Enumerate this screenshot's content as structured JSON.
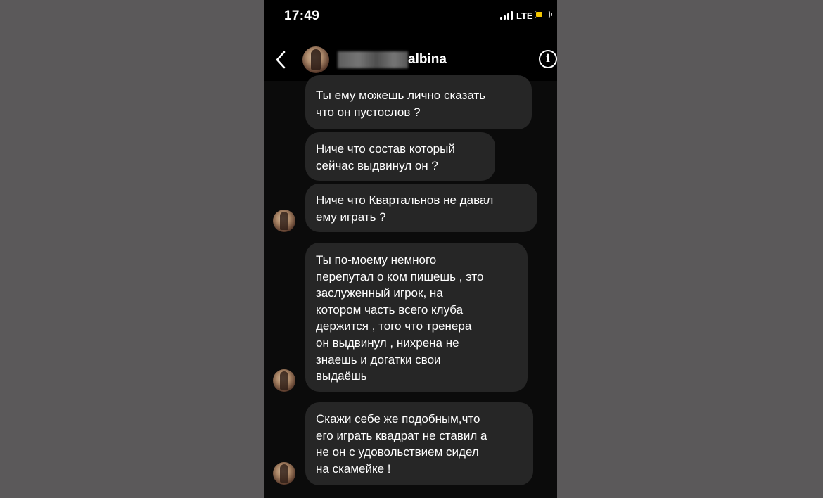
{
  "status_bar": {
    "time": "17:49",
    "network": "LTE",
    "battery_level": 0.55,
    "battery_color": "#f2c500"
  },
  "header": {
    "username": "albina",
    "back_icon": "chevron-left-icon",
    "info_icon": "info-icon",
    "info_glyph": "i"
  },
  "messages": [
    {
      "text": "Ты ему можешь лично сказать\nчто он пустослов ?"
    },
    {
      "text": "Ниче что состав который\nсейчас выдвинул он ?"
    },
    {
      "text": "Ниче что Квартальнов не давал\nему играть ?"
    },
    {
      "text": "Ты по-моему немного\nперепутал о ком пишешь , это\nзаслуженный игрок, на\nкотором часть всего клуба\nдержится  , того что тренера\nон выдвинул , нихрена не\nзнаешь и догатки свои\nвыдаёшь"
    },
    {
      "text": "Скажи себе же подобным,что\nего играть квадрат не ставил а\nне он с удовольствием сидел\nна скамейке !"
    }
  ],
  "colors": {
    "page_background": "#5b595a",
    "phone_background": "#000000",
    "bubble_background": "#262626",
    "text": "#ffffff"
  }
}
